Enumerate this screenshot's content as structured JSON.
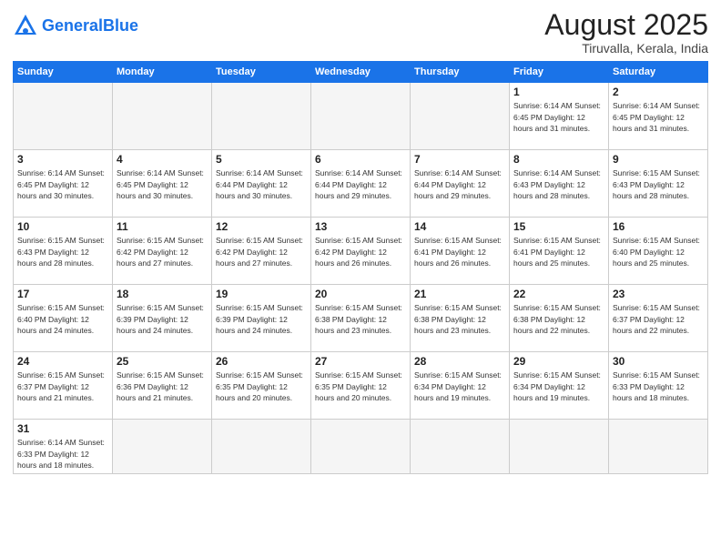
{
  "header": {
    "logo_general": "General",
    "logo_blue": "Blue",
    "title": "August 2025",
    "subtitle": "Tiruvalla, Kerala, India"
  },
  "days_of_week": [
    "Sunday",
    "Monday",
    "Tuesday",
    "Wednesday",
    "Thursday",
    "Friday",
    "Saturday"
  ],
  "weeks": [
    [
      {
        "day": "",
        "info": "",
        "empty": true
      },
      {
        "day": "",
        "info": "",
        "empty": true
      },
      {
        "day": "",
        "info": "",
        "empty": true
      },
      {
        "day": "",
        "info": "",
        "empty": true
      },
      {
        "day": "",
        "info": "",
        "empty": true
      },
      {
        "day": "1",
        "info": "Sunrise: 6:14 AM\nSunset: 6:45 PM\nDaylight: 12 hours\nand 31 minutes."
      },
      {
        "day": "2",
        "info": "Sunrise: 6:14 AM\nSunset: 6:45 PM\nDaylight: 12 hours\nand 31 minutes."
      }
    ],
    [
      {
        "day": "3",
        "info": "Sunrise: 6:14 AM\nSunset: 6:45 PM\nDaylight: 12 hours\nand 30 minutes."
      },
      {
        "day": "4",
        "info": "Sunrise: 6:14 AM\nSunset: 6:45 PM\nDaylight: 12 hours\nand 30 minutes."
      },
      {
        "day": "5",
        "info": "Sunrise: 6:14 AM\nSunset: 6:44 PM\nDaylight: 12 hours\nand 30 minutes."
      },
      {
        "day": "6",
        "info": "Sunrise: 6:14 AM\nSunset: 6:44 PM\nDaylight: 12 hours\nand 29 minutes."
      },
      {
        "day": "7",
        "info": "Sunrise: 6:14 AM\nSunset: 6:44 PM\nDaylight: 12 hours\nand 29 minutes."
      },
      {
        "day": "8",
        "info": "Sunrise: 6:14 AM\nSunset: 6:43 PM\nDaylight: 12 hours\nand 28 minutes."
      },
      {
        "day": "9",
        "info": "Sunrise: 6:15 AM\nSunset: 6:43 PM\nDaylight: 12 hours\nand 28 minutes."
      }
    ],
    [
      {
        "day": "10",
        "info": "Sunrise: 6:15 AM\nSunset: 6:43 PM\nDaylight: 12 hours\nand 28 minutes."
      },
      {
        "day": "11",
        "info": "Sunrise: 6:15 AM\nSunset: 6:42 PM\nDaylight: 12 hours\nand 27 minutes."
      },
      {
        "day": "12",
        "info": "Sunrise: 6:15 AM\nSunset: 6:42 PM\nDaylight: 12 hours\nand 27 minutes."
      },
      {
        "day": "13",
        "info": "Sunrise: 6:15 AM\nSunset: 6:42 PM\nDaylight: 12 hours\nand 26 minutes."
      },
      {
        "day": "14",
        "info": "Sunrise: 6:15 AM\nSunset: 6:41 PM\nDaylight: 12 hours\nand 26 minutes."
      },
      {
        "day": "15",
        "info": "Sunrise: 6:15 AM\nSunset: 6:41 PM\nDaylight: 12 hours\nand 25 minutes."
      },
      {
        "day": "16",
        "info": "Sunrise: 6:15 AM\nSunset: 6:40 PM\nDaylight: 12 hours\nand 25 minutes."
      }
    ],
    [
      {
        "day": "17",
        "info": "Sunrise: 6:15 AM\nSunset: 6:40 PM\nDaylight: 12 hours\nand 24 minutes."
      },
      {
        "day": "18",
        "info": "Sunrise: 6:15 AM\nSunset: 6:39 PM\nDaylight: 12 hours\nand 24 minutes."
      },
      {
        "day": "19",
        "info": "Sunrise: 6:15 AM\nSunset: 6:39 PM\nDaylight: 12 hours\nand 24 minutes."
      },
      {
        "day": "20",
        "info": "Sunrise: 6:15 AM\nSunset: 6:38 PM\nDaylight: 12 hours\nand 23 minutes."
      },
      {
        "day": "21",
        "info": "Sunrise: 6:15 AM\nSunset: 6:38 PM\nDaylight: 12 hours\nand 23 minutes."
      },
      {
        "day": "22",
        "info": "Sunrise: 6:15 AM\nSunset: 6:38 PM\nDaylight: 12 hours\nand 22 minutes."
      },
      {
        "day": "23",
        "info": "Sunrise: 6:15 AM\nSunset: 6:37 PM\nDaylight: 12 hours\nand 22 minutes."
      }
    ],
    [
      {
        "day": "24",
        "info": "Sunrise: 6:15 AM\nSunset: 6:37 PM\nDaylight: 12 hours\nand 21 minutes."
      },
      {
        "day": "25",
        "info": "Sunrise: 6:15 AM\nSunset: 6:36 PM\nDaylight: 12 hours\nand 21 minutes."
      },
      {
        "day": "26",
        "info": "Sunrise: 6:15 AM\nSunset: 6:35 PM\nDaylight: 12 hours\nand 20 minutes."
      },
      {
        "day": "27",
        "info": "Sunrise: 6:15 AM\nSunset: 6:35 PM\nDaylight: 12 hours\nand 20 minutes."
      },
      {
        "day": "28",
        "info": "Sunrise: 6:15 AM\nSunset: 6:34 PM\nDaylight: 12 hours\nand 19 minutes."
      },
      {
        "day": "29",
        "info": "Sunrise: 6:15 AM\nSunset: 6:34 PM\nDaylight: 12 hours\nand 19 minutes."
      },
      {
        "day": "30",
        "info": "Sunrise: 6:15 AM\nSunset: 6:33 PM\nDaylight: 12 hours\nand 18 minutes."
      }
    ],
    [
      {
        "day": "31",
        "info": "Sunrise: 6:14 AM\nSunset: 6:33 PM\nDaylight: 12 hours\nand 18 minutes."
      },
      {
        "day": "",
        "info": "",
        "empty": true
      },
      {
        "day": "",
        "info": "",
        "empty": true
      },
      {
        "day": "",
        "info": "",
        "empty": true
      },
      {
        "day": "",
        "info": "",
        "empty": true
      },
      {
        "day": "",
        "info": "",
        "empty": true
      },
      {
        "day": "",
        "info": "",
        "empty": true
      }
    ]
  ]
}
